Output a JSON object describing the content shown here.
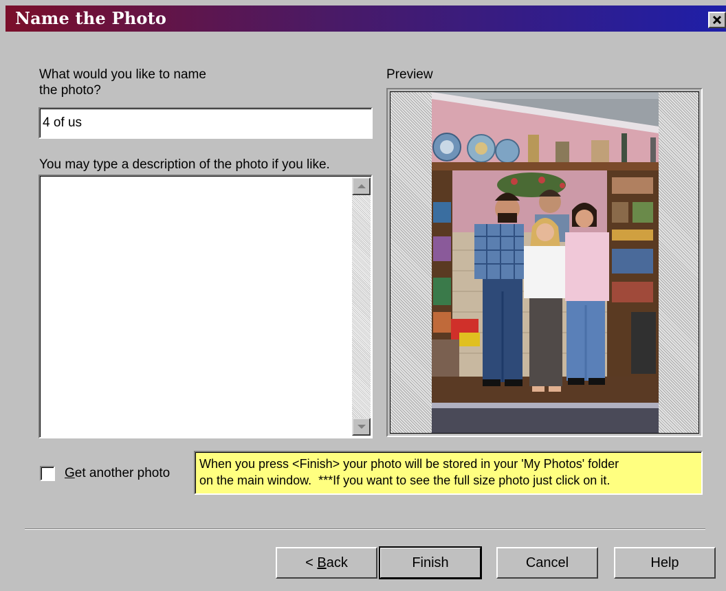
{
  "window": {
    "title": "Name the Photo"
  },
  "name_field": {
    "label_line1": "What would you like to name",
    "label_line2": "the photo?",
    "value": "4 of us"
  },
  "description": {
    "label": "You may type a description of the photo if you like.",
    "value": ""
  },
  "preview": {
    "label": "Preview"
  },
  "get_another": {
    "label_mnemonic": "G",
    "label_rest": "et another photo",
    "checked": false
  },
  "info": {
    "text": "When you press <Finish> your photo will be stored in your 'My Photos' folder\non the main window.  ***If you want to see the full size photo just click on it."
  },
  "buttons": {
    "back_prefix": "< ",
    "back_mnemonic": "B",
    "back_rest": "ack",
    "finish": "Finish",
    "cancel": "Cancel",
    "help": "Help"
  },
  "colors": {
    "title_start": "#7a0f2a",
    "title_end": "#1e1fa8",
    "info_background": "#ffff80",
    "dialog_background": "#c0c0c0"
  }
}
